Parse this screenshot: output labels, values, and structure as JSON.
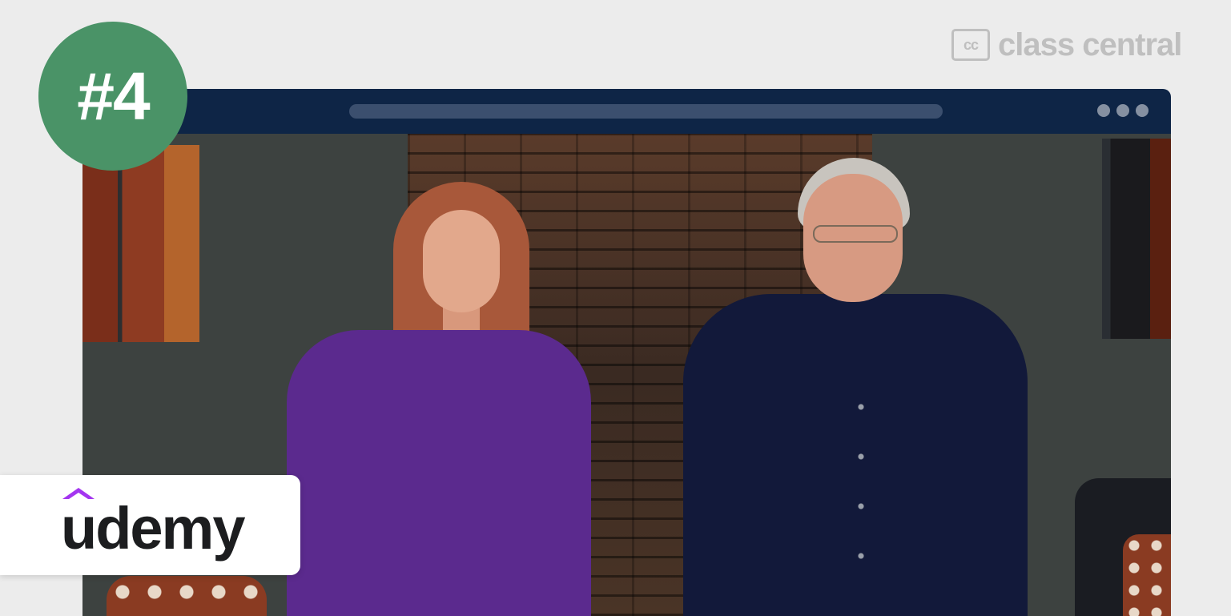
{
  "brand": {
    "name": "class central",
    "mark": "cc",
    "color": "#bfbfbf"
  },
  "rank": {
    "label": "#4",
    "color": "#4a9367"
  },
  "provider": {
    "name": "udemy",
    "accent": "#a435f0"
  },
  "browser": {
    "chrome_color": "#0e2546",
    "controls": [
      "dot-icon",
      "dot-icon",
      "dot-icon"
    ]
  }
}
